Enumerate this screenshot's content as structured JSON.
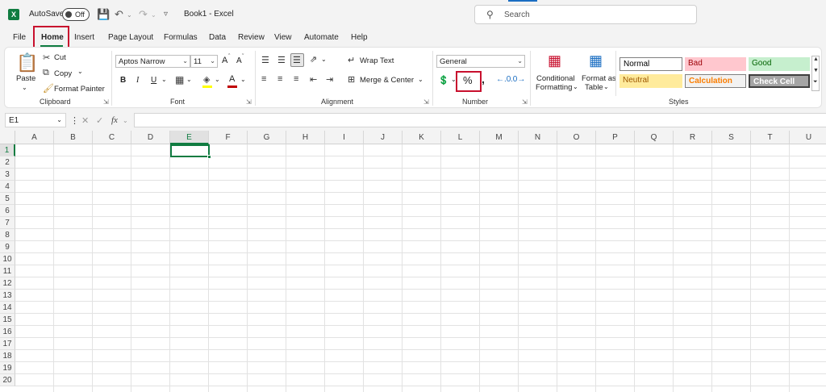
{
  "app": {
    "autosave_label": "AutoSave",
    "autosave_state": "Off",
    "doc_title": "Book1  -  Excel",
    "search_placeholder": "Search"
  },
  "tabs": [
    "File",
    "Home",
    "Insert",
    "Page Layout",
    "Formulas",
    "Data",
    "Review",
    "View",
    "Automate",
    "Help"
  ],
  "active_tab": "Home",
  "clipboard": {
    "paste": "Paste",
    "cut": "Cut",
    "copy": "Copy",
    "format_painter": "Format Painter",
    "group": "Clipboard"
  },
  "font": {
    "family": "Aptos Narrow",
    "size": "11",
    "bold": "B",
    "italic": "I",
    "underline": "U",
    "grow": "A",
    "shrink": "A",
    "font_color": "A",
    "group": "Font"
  },
  "alignment": {
    "wrap_text": "Wrap Text",
    "merge_center": "Merge & Center",
    "group": "Alignment"
  },
  "number": {
    "format": "General",
    "percent": "%",
    "comma": ",",
    "group": "Number"
  },
  "styles": {
    "conditional": "Conditional",
    "formatting": "Formatting",
    "format_as": "Format as",
    "table": "Table",
    "cells": [
      {
        "label": "Normal",
        "bg": "#ffffff",
        "fg": "#000000",
        "border": "#808080"
      },
      {
        "label": "Bad",
        "bg": "#ffc7ce",
        "fg": "#9c0006",
        "border": "#ffc7ce"
      },
      {
        "label": "Good",
        "bg": "#c6efce",
        "fg": "#006100",
        "border": "#c6efce"
      },
      {
        "label": "Neutral",
        "bg": "#ffeb9c",
        "fg": "#9c5700",
        "border": "#ffeb9c"
      },
      {
        "label": "Calculation",
        "bg": "#f2f2f2",
        "fg": "#fa7d00",
        "border": "#7f7f7f"
      },
      {
        "label": "Check Cell",
        "bg": "#a5a5a5",
        "fg": "#ffffff",
        "border": "#3f3f3f"
      }
    ],
    "group": "Styles"
  },
  "formula_bar": {
    "name_box": "E1",
    "fx": "fx",
    "value": ""
  },
  "grid": {
    "columns": [
      "A",
      "B",
      "C",
      "D",
      "E",
      "F",
      "G",
      "H",
      "I",
      "J",
      "K",
      "L",
      "M",
      "N",
      "O",
      "P",
      "Q",
      "R",
      "S",
      "T",
      "U"
    ],
    "rows": [
      "1",
      "2",
      "3",
      "4",
      "5",
      "6",
      "7",
      "8",
      "9",
      "10",
      "11",
      "12",
      "13",
      "14",
      "15",
      "16",
      "17",
      "18",
      "19",
      "20"
    ],
    "selected_column": "E",
    "selected_row": "1"
  },
  "colors": {
    "accent": "#107c41",
    "highlight": "#c8102e"
  }
}
